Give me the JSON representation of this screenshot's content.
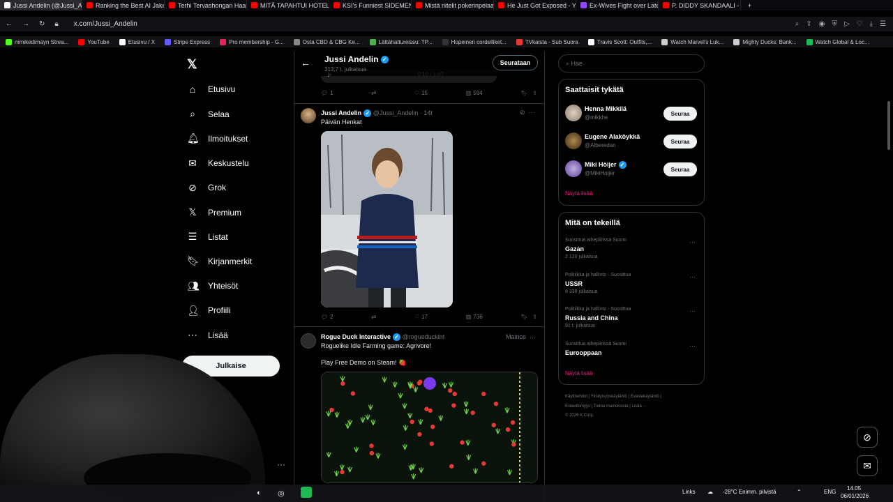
{
  "browser": {
    "tabs": [
      {
        "label": "Jussi Andelin (@Jussi_Andelin)",
        "color": "#ffffff"
      },
      {
        "label": "Ranking the Best AI Jake P",
        "color": "#ff0000"
      },
      {
        "label": "Terhi Tervashongan Haast",
        "color": "#ff0000"
      },
      {
        "label": "MITÄ TAPAHTUI HOTELLIS",
        "color": "#ff0000"
      },
      {
        "label": "KSI's Funniest SIDEMEN M",
        "color": "#ff0000"
      },
      {
        "label": "Mistä riitelit pokerinpelaaj",
        "color": "#ff0000"
      },
      {
        "label": "He Just Got Exposed - You",
        "color": "#ff0000"
      },
      {
        "label": "Ex-Wives Fight over Late",
        "color": "#9146ff"
      },
      {
        "label": "P. DIDDY SKANDAALI - Pr",
        "color": "#ff0000"
      }
    ],
    "url": "x.com/Jussi_Andelin",
    "bookmarks": [
      {
        "label": "mmikedimayn Strea...",
        "color": "#53fc18"
      },
      {
        "label": "YouTube",
        "color": "#ff0000"
      },
      {
        "label": "Etusivu / X",
        "color": "#ffffff"
      },
      {
        "label": "Stripe Express",
        "color": "#635bff"
      },
      {
        "label": "Pro membership - G...",
        "color": "#e0245e"
      },
      {
        "label": "Osta CBD & CBG Ke...",
        "color": "#888888"
      },
      {
        "label": "Lättähattureissu: TP...",
        "color": "#4caf50"
      },
      {
        "label": "Hopeinen cordelliket...",
        "color": "#333333"
      },
      {
        "label": "TVkaista - Sub Suora",
        "color": "#e53935"
      },
      {
        "label": "Travis Scott: Outfits,...",
        "color": "#ffffff"
      },
      {
        "label": "Watch Marvel's Luk...",
        "color": "#cccccc"
      },
      {
        "label": "Mighty Ducks: Bank...",
        "color": "#cccccc"
      },
      {
        "label": "Watch Global & Loc...",
        "color": "#1db954"
      }
    ]
  },
  "nav": {
    "items": [
      {
        "label": "Etusivu",
        "icon": "⌂"
      },
      {
        "label": "Selaa",
        "icon": "⌕"
      },
      {
        "label": "Ilmoitukset",
        "icon": "🔔︎"
      },
      {
        "label": "Keskustelu",
        "icon": "✉"
      },
      {
        "label": "Grok",
        "icon": "⊘"
      },
      {
        "label": "Premium",
        "icon": "𝕏"
      },
      {
        "label": "Listat",
        "icon": "☰"
      },
      {
        "label": "Kirjanmerkit",
        "icon": "🔖︎"
      },
      {
        "label": "Yhteisöt",
        "icon": "👥︎"
      },
      {
        "label": "Profiili",
        "icon": "👤︎"
      },
      {
        "label": "Lisää",
        "icon": "⋯"
      }
    ],
    "post_label": "Julkaise"
  },
  "profile_header": {
    "name": "Jussi Andelin",
    "posts": "313,7 t. julkaisua",
    "follow_label": "Seurataan",
    "video_time": "0:10 / 1:07"
  },
  "tweets": [
    {
      "replies": "1",
      "likes": "15",
      "views": "594"
    },
    {
      "name": "Jussi Andelin",
      "handle": "@Jussi_Andelin",
      "time": "· 14t",
      "text": "Päivän Henkat",
      "replies": "2",
      "likes": "17",
      "views": "736"
    },
    {
      "name": "Rogue Duck Interactive",
      "handle": "@rogueduckint",
      "ad_label": "Mainos",
      "text1": "Roguelike Idle Farming game: Agrivore!",
      "text2": "Play Free Demo on Steam! 🍓"
    }
  ],
  "right": {
    "search_placeholder": "Hae",
    "who_title": "Saattaisit tykätä",
    "suggestions": [
      {
        "name": "Henna Mikkilä",
        "handle": "@mikkhe",
        "verified": false
      },
      {
        "name": "Eugene Alaköykkä",
        "handle": "@Alberedan",
        "verified": false
      },
      {
        "name": "Miki Höijer",
        "handle": "@MikiHoijer",
        "verified": true
      }
    ],
    "follow_label": "Seuraa",
    "show_more": "Näytä lisää",
    "trends_title": "Mitä on tekeillä",
    "trends": [
      {
        "meta": "Suosittua aihepiirissä Suomi",
        "name": "Gazan",
        "count": "2 120 julkaisua"
      },
      {
        "meta": "Politiikka ja hallinto · Suosittua",
        "name": "USSR",
        "count": "8 338 julkaisua"
      },
      {
        "meta": "Politiikka ja hallinto · Suosittua",
        "name": "Russia and China",
        "count": "91 t. julkaisua"
      },
      {
        "meta": "Suosittua aihepiirissä Suomi",
        "name": "Eurooppaan",
        "count": ""
      }
    ],
    "footer1": "Käyttöehdot | Yksityisyyskäytäntö | Evästekäytäntö |",
    "footer2": "Esteettömyys | Tietoa mainoksista | Lisää ···",
    "footer3": "© 2026 X Corp."
  },
  "taskbar": {
    "links": "Links",
    "weather": "-28°C  Enimm. pilvistä",
    "lang": "ENG",
    "time": "14.05",
    "date": "06/01/2026"
  }
}
